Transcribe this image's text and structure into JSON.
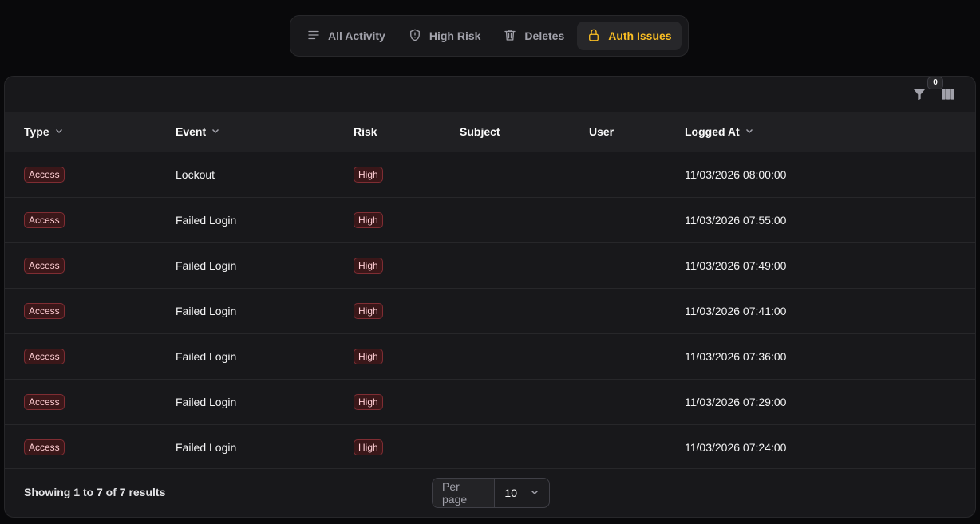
{
  "tabs": [
    {
      "label": "All Activity",
      "icon": "list-icon"
    },
    {
      "label": "High Risk",
      "icon": "shield-alert-icon"
    },
    {
      "label": "Deletes",
      "icon": "trash-icon"
    },
    {
      "label": "Auth Issues",
      "icon": "lock-icon",
      "active": true
    }
  ],
  "toolbar": {
    "filter_count": "0"
  },
  "table": {
    "columns": [
      "Type",
      "Event",
      "Risk",
      "Subject",
      "User",
      "Logged At"
    ],
    "rows": [
      {
        "type": "Access",
        "event": "Lockout",
        "risk": "High",
        "subject": "",
        "user": "",
        "logged_at": "11/03/2026 08:00:00"
      },
      {
        "type": "Access",
        "event": "Failed Login",
        "risk": "High",
        "subject": "",
        "user": "",
        "logged_at": "11/03/2026 07:55:00"
      },
      {
        "type": "Access",
        "event": "Failed Login",
        "risk": "High",
        "subject": "",
        "user": "",
        "logged_at": "11/03/2026 07:49:00"
      },
      {
        "type": "Access",
        "event": "Failed Login",
        "risk": "High",
        "subject": "",
        "user": "",
        "logged_at": "11/03/2026 07:41:00"
      },
      {
        "type": "Access",
        "event": "Failed Login",
        "risk": "High",
        "subject": "",
        "user": "",
        "logged_at": "11/03/2026 07:36:00"
      },
      {
        "type": "Access",
        "event": "Failed Login",
        "risk": "High",
        "subject": "",
        "user": "",
        "logged_at": "11/03/2026 07:29:00"
      },
      {
        "type": "Access",
        "event": "Failed Login",
        "risk": "High",
        "subject": "",
        "user": "",
        "logged_at": "11/03/2026 07:24:00"
      }
    ]
  },
  "footer": {
    "summary": "Showing 1 to 7 of 7 results",
    "per_page_label": "Per page",
    "per_page_value": "10"
  },
  "colors": {
    "accent": "#fbbf24",
    "danger_badge": "#7f2d33",
    "background": "#09090b",
    "card": "#18181b"
  }
}
